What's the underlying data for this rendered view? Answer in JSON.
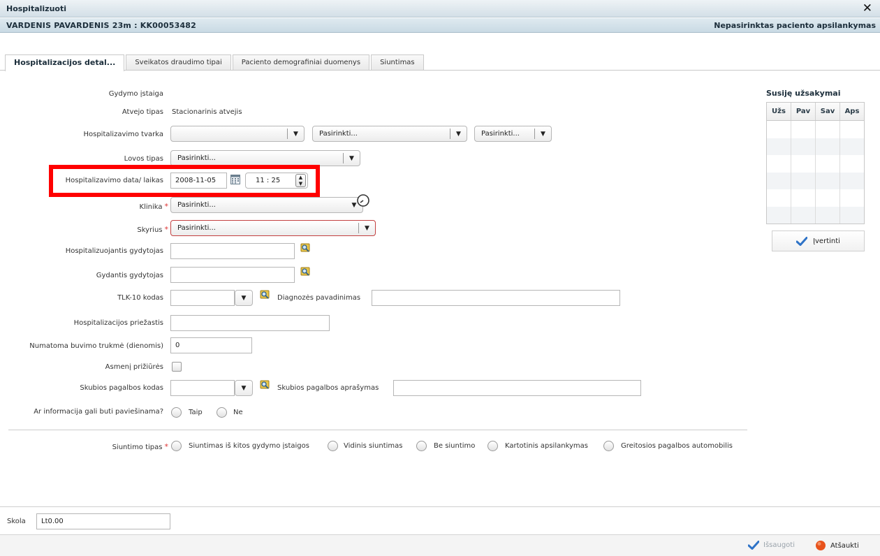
{
  "window": {
    "title": "Hospitalizuoti",
    "close_glyph": "✕"
  },
  "patient": {
    "name_and_id": "VARDENIS PAVARDENIS 23m  :  KK00053482",
    "visit_status": "Nepasirinktas paciento apsilankymas"
  },
  "tabs": [
    {
      "label": "Hospitalizacijos detal...",
      "active": true
    },
    {
      "label": "Sveikatos draudimo tipai",
      "active": false
    },
    {
      "label": "Paciento demografiniai duomenys",
      "active": false
    },
    {
      "label": "Siuntimas",
      "active": false
    }
  ],
  "form": {
    "gydymo_istaiga": {
      "label": "Gydymo įstaiga",
      "value": ""
    },
    "atvejo_tipas": {
      "label": "Atvejo tipas",
      "value": "Stacionarinis atvejis"
    },
    "hosp_tvarka": {
      "label": "Hospitalizavimo tvarka",
      "select1": "",
      "select2": "Pasirinkti...",
      "select3": "Pasirinkti..."
    },
    "lovos_tipas": {
      "label": "Lovos tipas",
      "value": "Pasirinkti..."
    },
    "hosp_data": {
      "label": "Hospitalizavimo data/ laikas",
      "date": "2008-11-05",
      "time": "11 : 25"
    },
    "klinika": {
      "label": "Klinika",
      "value": "Pasirinkti..."
    },
    "skyrius": {
      "label": "Skyrius",
      "value": "Pasirinkti..."
    },
    "hosp_gydytojas": {
      "label": "Hospitalizuojantis gydytojas",
      "value": ""
    },
    "gydantis_gydytojas": {
      "label": "Gydantis gydytojas",
      "value": ""
    },
    "tlk10": {
      "label": "TLK-10 kodas",
      "value": "",
      "diag_label": "Diagnozės pavadinimas",
      "diag_value": ""
    },
    "priezastis": {
      "label": "Hospitalizacijos priežastis",
      "value": ""
    },
    "trukme": {
      "label": "Numatoma buvimo trukmė (dienomis)",
      "value": "0"
    },
    "asmeni_priziures": {
      "label": "Asmenį prižiūrės",
      "checked": false
    },
    "skubios": {
      "label": "Skubios pagalbos kodas",
      "value": "",
      "desc_label": "Skubios pagalbos aprašymas",
      "desc_value": ""
    },
    "info": {
      "label": "Ar informacija gali buti paviešinama?",
      "yes": "Taip",
      "no": "Ne"
    },
    "siuntimo_tipas": {
      "label": "Siuntimo tipas",
      "options": [
        "Siuntimas iš kitos gydymo įstaigos",
        "Vidinis siuntimas",
        "Be siuntimo",
        "Kartotinis apsilankymas",
        "Greitosios pagalbos automobilis"
      ]
    },
    "required_mark": "*"
  },
  "related": {
    "title": "Susiję užsakymai",
    "columns": [
      "Užs",
      "Pav",
      "Sav",
      "Aps"
    ],
    "evaluate_label": "Įvertinti"
  },
  "footer": {
    "skola_label": "Skola",
    "skola_value": "Lt0.00",
    "save_label": "Išsaugoti",
    "cancel_label": "Atšaukti"
  },
  "colors": {
    "accent_blue": "#2e73c7",
    "required_red": "#d33333",
    "highlight_red": "#ff0000",
    "cancel_orange": "#e8531c"
  },
  "icons": {
    "close": "close-icon",
    "calendar": "calendar-icon",
    "lookup": "lookup-icon",
    "clock": "clock-icon",
    "check": "checkmark-icon",
    "cancel": "cancel-dot-icon"
  }
}
